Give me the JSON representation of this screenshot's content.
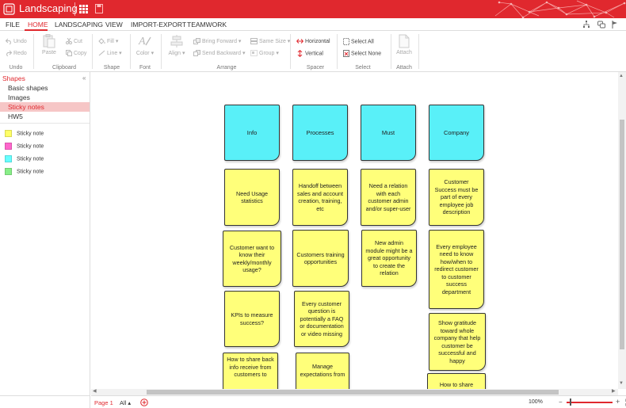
{
  "app": {
    "title": "Landscaping",
    "accent_color": "#e0282e"
  },
  "menu": {
    "items": [
      "FILE",
      "HOME",
      "LANDSCAPING",
      "VIEW",
      "IMPORT-EXPORT",
      "TEAMWORK"
    ],
    "active": "HOME",
    "right_icons": [
      "org-chart-icon",
      "comments-icon",
      "flag-icon"
    ]
  },
  "ribbon": {
    "undo": {
      "undo": "Undo",
      "redo": "Redo",
      "title": "Undo"
    },
    "clipboard": {
      "paste": "Paste",
      "cut": "Cut",
      "copy": "Copy",
      "title": "Clipboard"
    },
    "shape": {
      "fill": "Fill",
      "line": "Line",
      "title": "Shape"
    },
    "font": {
      "color": "Color",
      "title": "Font"
    },
    "arrange": {
      "align": "Align",
      "bring_forward": "Bring Forward",
      "send_backward": "Send Backward",
      "same_size": "Same Size",
      "group": "Group",
      "title": "Arrange"
    },
    "spacer": {
      "horizontal": "Horizontal",
      "vertical": "Vertical",
      "title": "Spacer"
    },
    "select": {
      "select_all": "Select All",
      "select_none": "Select None",
      "title": "Select"
    },
    "attach": {
      "attach": "Attach",
      "title": "Attach"
    }
  },
  "shapes_panel": {
    "title": "Shapes",
    "collapse": "«",
    "categories": [
      "Basic shapes",
      "Images",
      "Sticky notes",
      "HW5"
    ],
    "selected_category": "Sticky notes",
    "shapes": [
      {
        "label": "Sticky note",
        "color": "#ffff66"
      },
      {
        "label": "Sticky note",
        "color": "#ff66cc"
      },
      {
        "label": "Sticky note",
        "color": "#66ffff"
      },
      {
        "label": "Sticky note",
        "color": "#88ee88"
      }
    ]
  },
  "canvas": {
    "headers": [
      "Info",
      "Processes",
      "Must",
      "Company"
    ],
    "columns": [
      [
        "Need Usage statistics",
        "Customer want to know their weekly/monthly usage?",
        "KPIs to measure success?",
        "How to share back info receive from customers to"
      ],
      [
        "Handoff between sales and account creation, training, etc",
        "Customers training opportunities",
        "Every customer question is potentially a FAQ or documentation or video missing",
        "Manage expectations from"
      ],
      [
        "Need a relation with each customer admin and/or super-user",
        "New admin module might be a great opportunity to create the relation"
      ],
      [
        "Customer Success must be part of every employee job description",
        "Every employee need to know how/when to redirect customer to customer success department",
        "Show gratitude toward whole company that help customer be successful and happy",
        "How to share"
      ]
    ],
    "note_colors": {
      "header": "#59f0f8",
      "body": "#ffff7a"
    }
  },
  "bottom": {
    "page": "Page 1",
    "all": "All",
    "zoom": "100%"
  }
}
